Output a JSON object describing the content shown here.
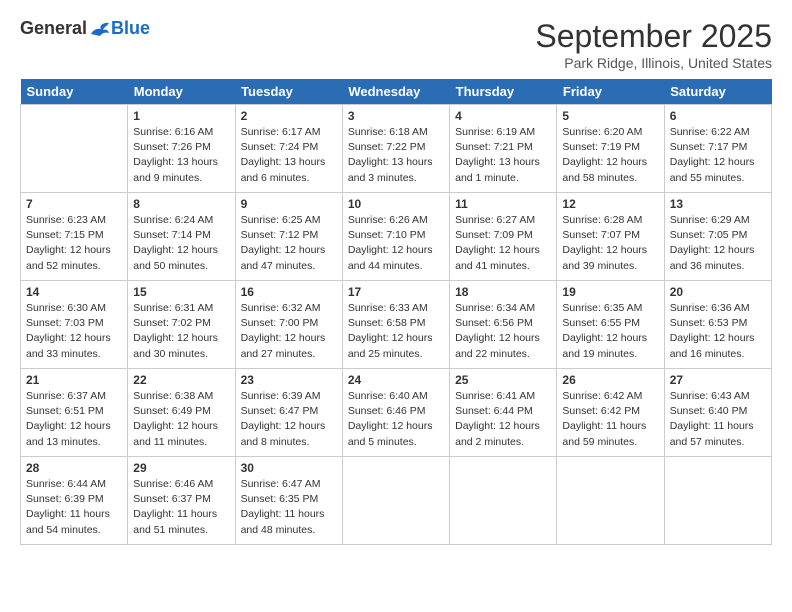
{
  "header": {
    "logo_general": "General",
    "logo_blue": "Blue",
    "month_title": "September 2025",
    "location": "Park Ridge, Illinois, United States"
  },
  "weekdays": [
    "Sunday",
    "Monday",
    "Tuesday",
    "Wednesday",
    "Thursday",
    "Friday",
    "Saturday"
  ],
  "weeks": [
    [
      {
        "day": "",
        "info": ""
      },
      {
        "day": "1",
        "info": "Sunrise: 6:16 AM\nSunset: 7:26 PM\nDaylight: 13 hours\nand 9 minutes."
      },
      {
        "day": "2",
        "info": "Sunrise: 6:17 AM\nSunset: 7:24 PM\nDaylight: 13 hours\nand 6 minutes."
      },
      {
        "day": "3",
        "info": "Sunrise: 6:18 AM\nSunset: 7:22 PM\nDaylight: 13 hours\nand 3 minutes."
      },
      {
        "day": "4",
        "info": "Sunrise: 6:19 AM\nSunset: 7:21 PM\nDaylight: 13 hours\nand 1 minute."
      },
      {
        "day": "5",
        "info": "Sunrise: 6:20 AM\nSunset: 7:19 PM\nDaylight: 12 hours\nand 58 minutes."
      },
      {
        "day": "6",
        "info": "Sunrise: 6:22 AM\nSunset: 7:17 PM\nDaylight: 12 hours\nand 55 minutes."
      }
    ],
    [
      {
        "day": "7",
        "info": "Sunrise: 6:23 AM\nSunset: 7:15 PM\nDaylight: 12 hours\nand 52 minutes."
      },
      {
        "day": "8",
        "info": "Sunrise: 6:24 AM\nSunset: 7:14 PM\nDaylight: 12 hours\nand 50 minutes."
      },
      {
        "day": "9",
        "info": "Sunrise: 6:25 AM\nSunset: 7:12 PM\nDaylight: 12 hours\nand 47 minutes."
      },
      {
        "day": "10",
        "info": "Sunrise: 6:26 AM\nSunset: 7:10 PM\nDaylight: 12 hours\nand 44 minutes."
      },
      {
        "day": "11",
        "info": "Sunrise: 6:27 AM\nSunset: 7:09 PM\nDaylight: 12 hours\nand 41 minutes."
      },
      {
        "day": "12",
        "info": "Sunrise: 6:28 AM\nSunset: 7:07 PM\nDaylight: 12 hours\nand 39 minutes."
      },
      {
        "day": "13",
        "info": "Sunrise: 6:29 AM\nSunset: 7:05 PM\nDaylight: 12 hours\nand 36 minutes."
      }
    ],
    [
      {
        "day": "14",
        "info": "Sunrise: 6:30 AM\nSunset: 7:03 PM\nDaylight: 12 hours\nand 33 minutes."
      },
      {
        "day": "15",
        "info": "Sunrise: 6:31 AM\nSunset: 7:02 PM\nDaylight: 12 hours\nand 30 minutes."
      },
      {
        "day": "16",
        "info": "Sunrise: 6:32 AM\nSunset: 7:00 PM\nDaylight: 12 hours\nand 27 minutes."
      },
      {
        "day": "17",
        "info": "Sunrise: 6:33 AM\nSunset: 6:58 PM\nDaylight: 12 hours\nand 25 minutes."
      },
      {
        "day": "18",
        "info": "Sunrise: 6:34 AM\nSunset: 6:56 PM\nDaylight: 12 hours\nand 22 minutes."
      },
      {
        "day": "19",
        "info": "Sunrise: 6:35 AM\nSunset: 6:55 PM\nDaylight: 12 hours\nand 19 minutes."
      },
      {
        "day": "20",
        "info": "Sunrise: 6:36 AM\nSunset: 6:53 PM\nDaylight: 12 hours\nand 16 minutes."
      }
    ],
    [
      {
        "day": "21",
        "info": "Sunrise: 6:37 AM\nSunset: 6:51 PM\nDaylight: 12 hours\nand 13 minutes."
      },
      {
        "day": "22",
        "info": "Sunrise: 6:38 AM\nSunset: 6:49 PM\nDaylight: 12 hours\nand 11 minutes."
      },
      {
        "day": "23",
        "info": "Sunrise: 6:39 AM\nSunset: 6:47 PM\nDaylight: 12 hours\nand 8 minutes."
      },
      {
        "day": "24",
        "info": "Sunrise: 6:40 AM\nSunset: 6:46 PM\nDaylight: 12 hours\nand 5 minutes."
      },
      {
        "day": "25",
        "info": "Sunrise: 6:41 AM\nSunset: 6:44 PM\nDaylight: 12 hours\nand 2 minutes."
      },
      {
        "day": "26",
        "info": "Sunrise: 6:42 AM\nSunset: 6:42 PM\nDaylight: 11 hours\nand 59 minutes."
      },
      {
        "day": "27",
        "info": "Sunrise: 6:43 AM\nSunset: 6:40 PM\nDaylight: 11 hours\nand 57 minutes."
      }
    ],
    [
      {
        "day": "28",
        "info": "Sunrise: 6:44 AM\nSunset: 6:39 PM\nDaylight: 11 hours\nand 54 minutes."
      },
      {
        "day": "29",
        "info": "Sunrise: 6:46 AM\nSunset: 6:37 PM\nDaylight: 11 hours\nand 51 minutes."
      },
      {
        "day": "30",
        "info": "Sunrise: 6:47 AM\nSunset: 6:35 PM\nDaylight: 11 hours\nand 48 minutes."
      },
      {
        "day": "",
        "info": ""
      },
      {
        "day": "",
        "info": ""
      },
      {
        "day": "",
        "info": ""
      },
      {
        "day": "",
        "info": ""
      }
    ]
  ]
}
